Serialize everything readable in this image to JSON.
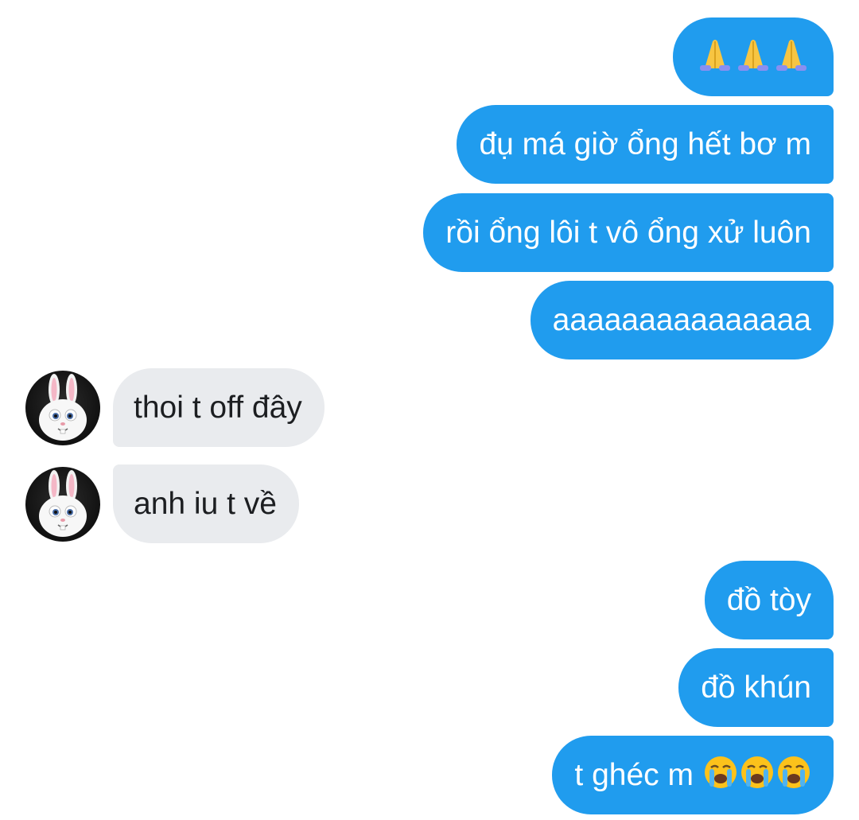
{
  "conversation": {
    "messages": [
      {
        "id": "m1",
        "direction": "out",
        "text": "",
        "emoji": [
          "folded-hands",
          "folded-hands",
          "folded-hands"
        ]
      },
      {
        "id": "m2",
        "direction": "out",
        "text": "đụ má giờ ổng hết bơ m"
      },
      {
        "id": "m3",
        "direction": "out",
        "text": "rồi ổng lôi t vô ổng xử luôn"
      },
      {
        "id": "m4",
        "direction": "out",
        "text": "aaaaaaaaaaaaaaa"
      },
      {
        "id": "m5",
        "direction": "in",
        "text": "thoi t off đây",
        "avatar": "bunny-avatar"
      },
      {
        "id": "m6",
        "direction": "in",
        "text": "anh iu t về",
        "avatar": "bunny-avatar"
      },
      {
        "id": "m7",
        "direction": "out",
        "text": "đồ tòy"
      },
      {
        "id": "m8",
        "direction": "out",
        "text": "đồ khún"
      },
      {
        "id": "m9",
        "direction": "out",
        "text": "t ghéc m",
        "emoji": [
          "loudly-crying-face",
          "loudly-crying-face",
          "loudly-crying-face"
        ]
      }
    ]
  },
  "colors": {
    "sent_bubble": "#209cee",
    "received_bubble": "#e9ebee",
    "sent_text": "#ffffff",
    "received_text": "#1c1e21",
    "background": "#ffffff"
  }
}
